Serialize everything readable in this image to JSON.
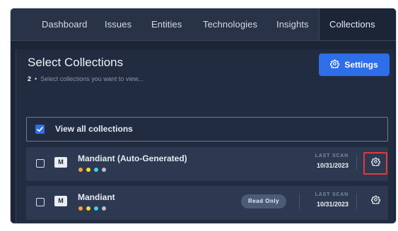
{
  "nav": {
    "items": [
      {
        "label": "Dashboard"
      },
      {
        "label": "Issues"
      },
      {
        "label": "Entities"
      },
      {
        "label": "Technologies"
      },
      {
        "label": "Insights"
      },
      {
        "label": "Collections",
        "active": true
      }
    ]
  },
  "panel": {
    "title": "Select Collections",
    "selected_count": "2",
    "subtitle": "Select collections you want to view...",
    "settings_label": "Settings"
  },
  "view_all": {
    "label": "View all collections",
    "checked": true
  },
  "collections": [
    {
      "badge": "M",
      "name": "Mandiant (Auto-Generated)",
      "read_only": "",
      "last_scan_label": "LAST SCAN",
      "last_scan_date": "10/31/2023",
      "highlighted_gear": true,
      "dots": [
        "#ff9d3d",
        "#f5d836",
        "#3fd0e0",
        "#b9bfcb"
      ]
    },
    {
      "badge": "M",
      "name": "Mandiant",
      "read_only": "Read Only",
      "last_scan_label": "LAST SCAN",
      "last_scan_date": "10/31/2023",
      "highlighted_gear": false,
      "dots": [
        "#ff9d3d",
        "#f5d836",
        "#3fd0e0",
        "#b9bfcb"
      ]
    }
  ],
  "colors": {
    "accent": "#2e6ee8",
    "highlight": "#e03a3a"
  }
}
